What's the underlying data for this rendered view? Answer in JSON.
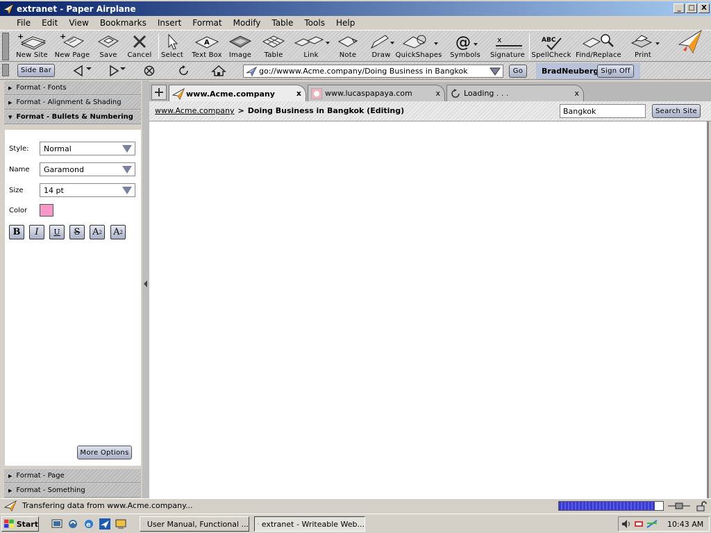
{
  "window": {
    "title": "extranet - Paper Airplane",
    "buttons": [
      "_",
      "□",
      "X"
    ]
  },
  "menu": [
    "File",
    "Edit",
    "View",
    "Bookmarks",
    "Insert",
    "Format",
    "Modify",
    "Table",
    "Tools",
    "Help"
  ],
  "toolbar": {
    "new_site": "New Site",
    "new_page": "New Page",
    "save": "Save",
    "cancel": "Cancel",
    "select": "Select",
    "text_box": "Text Box",
    "image": "Image",
    "table": "Table",
    "link": "Link",
    "note": "Note",
    "draw": "Draw",
    "quickshapes": "QuickShapes",
    "symbols": "Symbols",
    "signature": "Signature",
    "spellcheck": "SpellCheck",
    "find_replace": "Find/Replace",
    "print": "Print"
  },
  "nav": {
    "sidebar_label": "Side Bar",
    "address_value": "go://wwww.Acme.company/Doing Business in Bangkok",
    "go_label": "Go",
    "username": "BradNeuberg",
    "signoff_label": "Sign Off"
  },
  "sidebar": {
    "sections": [
      "Format - Fonts",
      "Format - Alignment & Shading",
      "Format - Bullets & Numbering",
      "Format - Page",
      "Format - Something"
    ],
    "style_label": "Style:",
    "style_value": "Normal",
    "name_label": "Name",
    "name_value": "Garamond",
    "size_label": "Size",
    "size_value": "14 pt",
    "color_label": "Color",
    "color_value": "#f59ac8",
    "format_buttons": [
      "B",
      "I",
      "U",
      "S",
      "A",
      "A"
    ],
    "superscript": "2",
    "subscript": "2",
    "more_options": "More Options"
  },
  "tabs": [
    {
      "label": "www.Acme.company",
      "close": "x"
    },
    {
      "label": "www.lucaspapaya.com",
      "close": "x"
    },
    {
      "label": "Loading . . .",
      "close": "x"
    }
  ],
  "breadcrumb": {
    "link": "www.Acme.company",
    "separator": ">",
    "current": "Doing Business in Bangkok (Editing)"
  },
  "search": {
    "value": "Bangkok",
    "button": "Search Site"
  },
  "status": {
    "text": "Transfering data from www.Acme.company...",
    "progress": 0.92
  },
  "taskbar": {
    "start": "Start",
    "tasks": [
      "User Manual, Functional ...",
      "extranet - Writeable Web..."
    ],
    "clock": "10:43 AM"
  }
}
